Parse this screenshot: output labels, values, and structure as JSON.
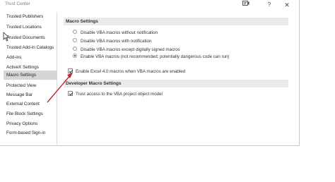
{
  "window": {
    "title": "Trust Center",
    "feedback_icon": "feedback-icon",
    "help_label": "?",
    "close_label": "✕"
  },
  "sidebar": {
    "items": [
      {
        "label": "Trusted Publishers",
        "selected": false
      },
      {
        "label": "Trusted Locations",
        "selected": false
      },
      {
        "label": "Trusted Documents",
        "selected": false
      },
      {
        "label": "Trusted Add-in Catalogs",
        "selected": false
      },
      {
        "label": "Add-ins",
        "selected": false
      },
      {
        "label": "ActiveX Settings",
        "selected": false
      },
      {
        "label": "Macro Settings",
        "selected": true
      },
      {
        "label": "Protected View",
        "selected": false
      },
      {
        "label": "Message Bar",
        "selected": false
      },
      {
        "label": "External Content",
        "selected": false
      },
      {
        "label": "File Block Settings",
        "selected": false
      },
      {
        "label": "Privacy Options",
        "selected": false
      },
      {
        "label": "Form-based Sign-in",
        "selected": false
      }
    ]
  },
  "macro_settings": {
    "header": "Macro Settings",
    "options": [
      {
        "label": "Disable VBA macros without notification",
        "checked": false
      },
      {
        "label": "Disable VBA macros with notification",
        "checked": false
      },
      {
        "label": "Disable VBA macros except digitally signed macros",
        "checked": false
      },
      {
        "label": "Enable VBA macros (not recommended; potentially dangerous code can run)",
        "checked": true
      }
    ],
    "excel4_checkbox": {
      "label": "Enable Excel 4.0 macros when VBA macros are enabled",
      "checked": true
    }
  },
  "developer_settings": {
    "header": "Developer Macro Settings",
    "trust_vba_checkbox": {
      "label": "Trust access to the VBA project object model",
      "checked": true
    }
  },
  "annotation": {
    "arrow_color": "#c0282d"
  }
}
